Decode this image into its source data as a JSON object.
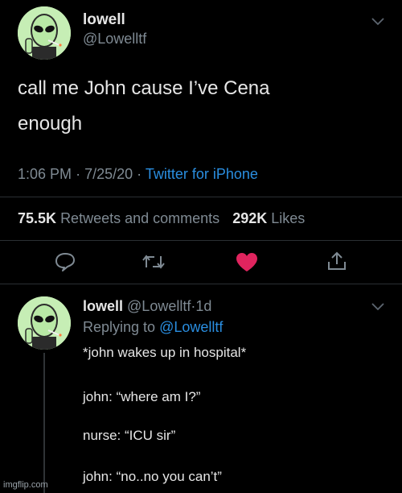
{
  "tweet": {
    "display_name": "lowell",
    "handle": "@Lowelltf",
    "text_line1": "call me John cause I’ve Cena",
    "text_line2": "enough",
    "time": "1:06 PM",
    "date": "7/25/20",
    "source": "Twitter for iPhone",
    "retweets_count": "75.5K",
    "retweets_label": "Retweets and comments",
    "likes_count": "292K",
    "likes_label": "Likes"
  },
  "reply": {
    "display_name": "lowell",
    "handle": "@Lowelltf",
    "age": "1d",
    "replying_prefix": "Replying to",
    "replying_to": "@Lowelltf",
    "line1": "*john wakes up in hospital*",
    "line2": "john: “where am I?”",
    "line3": "nurse: “ICU sir”",
    "line4": "john: “no..no you can’t”"
  },
  "actions": {
    "reply_icon": "comment-bubble-icon",
    "retweet_icon": "retweet-icon",
    "like_icon": "heart-icon",
    "share_icon": "share-icon",
    "like_color": "#e0245e"
  },
  "watermark": "imgflip.com"
}
